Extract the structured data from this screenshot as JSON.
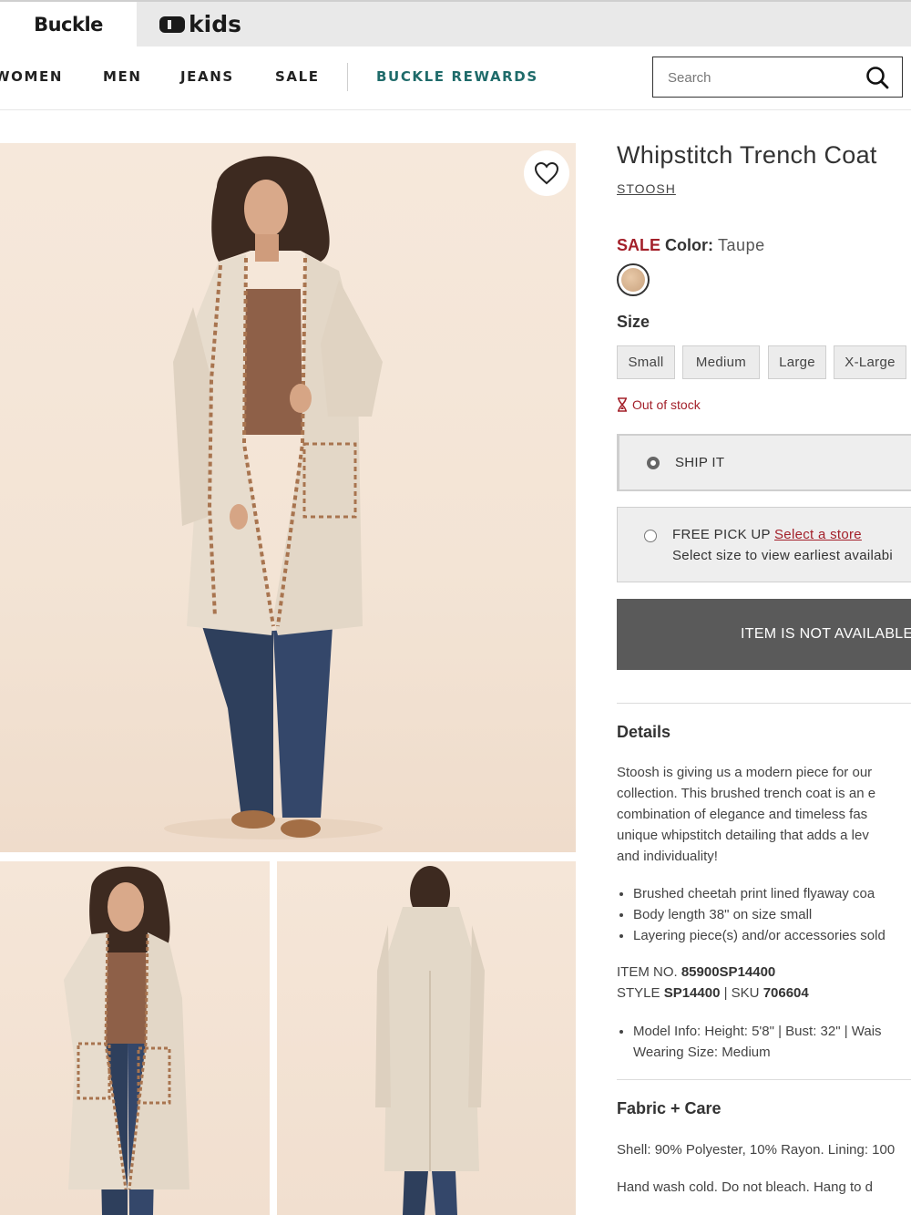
{
  "brandbar": {
    "buckle_label": "Buckle",
    "kids_label": "kids"
  },
  "nav": {
    "items": [
      "WOMEN",
      "MEN",
      "JEANS",
      "SALE"
    ],
    "rewards": "BUCKLE REWARDS",
    "search_placeholder": "Search"
  },
  "product": {
    "title": "Whipstitch Trench Coat",
    "brand": "STOOSH",
    "sale_label": "SALE",
    "color_label": "Color:",
    "color_value": "Taupe",
    "swatch_color": "#d2ad89",
    "size_label": "Size",
    "sizes": [
      "Small",
      "Medium",
      "Large",
      "X-Large"
    ],
    "stock_status": "Out of stock",
    "ship_label": "SHIP IT",
    "pickup_label": "FREE PICK UP",
    "select_store": "Select a store",
    "pickup_note": "Select size to view earliest availabi",
    "cta": "ITEM IS NOT AVAILABLE"
  },
  "details": {
    "title": "Details",
    "description": [
      "Stoosh is giving us a modern piece for our",
      "collection. This brushed trench coat is an e",
      "combination of elegance and timeless fas",
      "unique whipstitch detailing that adds a lev",
      "and individuality!"
    ],
    "bullets": [
      "Brushed cheetah print lined flyaway coa",
      "Body length 38\" on size small",
      "Layering piece(s) and/or accessories sold"
    ],
    "item_no_label": "ITEM NO.",
    "item_no": "85900SP14400",
    "style_label": "STYLE",
    "style": "SP14400",
    "sku_label": "| SKU",
    "sku": "706604",
    "model_info_line1": "Model Info: Height: 5'8\" | Bust: 32\" | Wais",
    "model_info_line2": "Wearing Size: Medium"
  },
  "fabric": {
    "title": "Fabric + Care",
    "content": "Shell: 90% Polyester, 10% Rayon. Lining: 100",
    "care": "Hand wash cold. Do not bleach. Hang to d"
  },
  "colors": {
    "sale_red": "#a3202a",
    "rewards_teal": "#1f6b6a",
    "cta_gray": "#5a5a5a"
  }
}
